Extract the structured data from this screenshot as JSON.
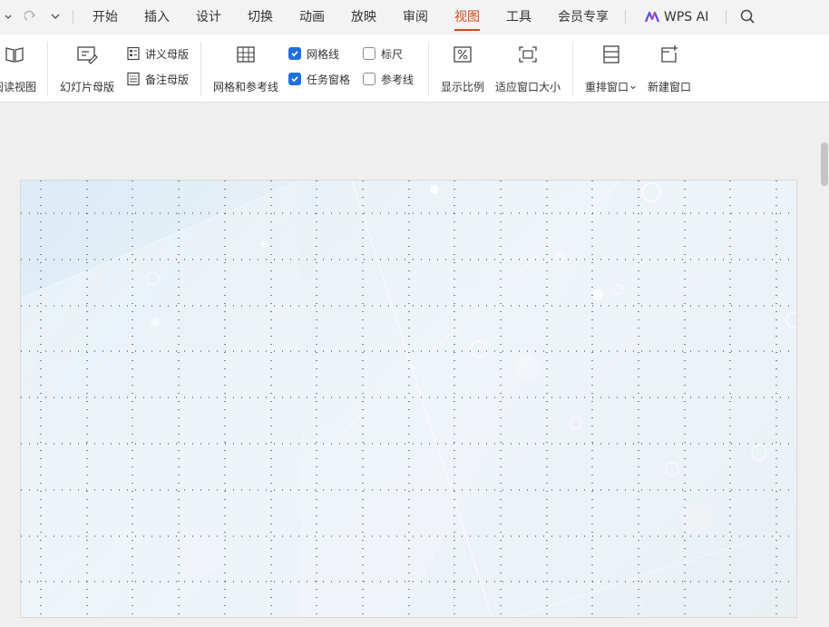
{
  "menubar": {
    "tabs": [
      {
        "label": "开始"
      },
      {
        "label": "插入"
      },
      {
        "label": "设计"
      },
      {
        "label": "切换"
      },
      {
        "label": "动画"
      },
      {
        "label": "放映"
      },
      {
        "label": "审阅"
      },
      {
        "label": "视图",
        "active": true
      },
      {
        "label": "工具"
      },
      {
        "label": "会员专享"
      }
    ],
    "wps_ai_label": "WPS AI"
  },
  "ribbon": {
    "reading_view_label": "阅读视图",
    "slide_master_label": "幻灯片母版",
    "handout_master_label": "讲义母版",
    "notes_master_label": "备注母版",
    "grid_guides_label": "网格和参考线",
    "gridlines": {
      "label": "网格线",
      "checked": true
    },
    "task_pane": {
      "label": "任务窗格",
      "checked": true
    },
    "ruler": {
      "label": "标尺",
      "checked": false
    },
    "guides": {
      "label": "参考线",
      "checked": false
    },
    "zoom_label": "显示比例",
    "fit_window_label": "适应窗口大小",
    "arrange_windows_label": "重排窗口",
    "new_window_label": "新建窗口"
  },
  "colors": {
    "accent": "#d04a1a",
    "checkbox": "#1f6fe0"
  }
}
